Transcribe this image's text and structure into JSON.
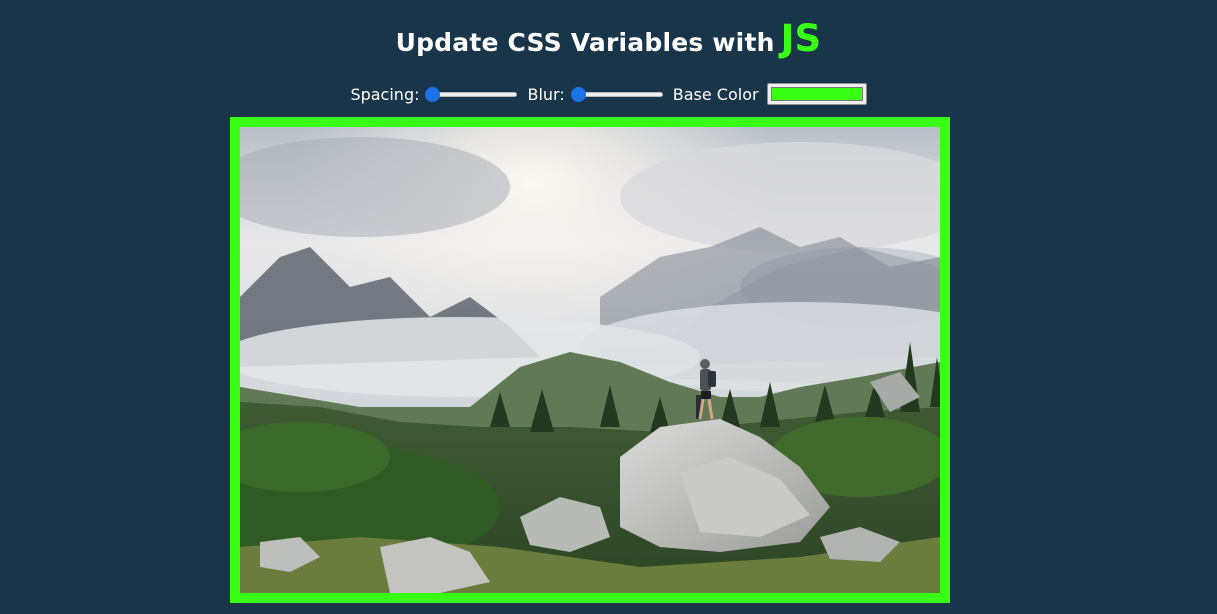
{
  "header": {
    "title_prefix": "Update CSS Variables with",
    "title_highlight": "JS"
  },
  "controls": {
    "spacing": {
      "label": "Spacing:",
      "value_fraction": 0.0
    },
    "blur": {
      "label": "Blur:",
      "value_fraction": 0.0
    },
    "base_color": {
      "label": "Base Color",
      "value": "#39ff14"
    }
  },
  "colors": {
    "background": "#193549",
    "accent": "#39ff14",
    "slider_thumb": "#1a73e8"
  },
  "image": {
    "description_icon": "landscape-photo"
  }
}
